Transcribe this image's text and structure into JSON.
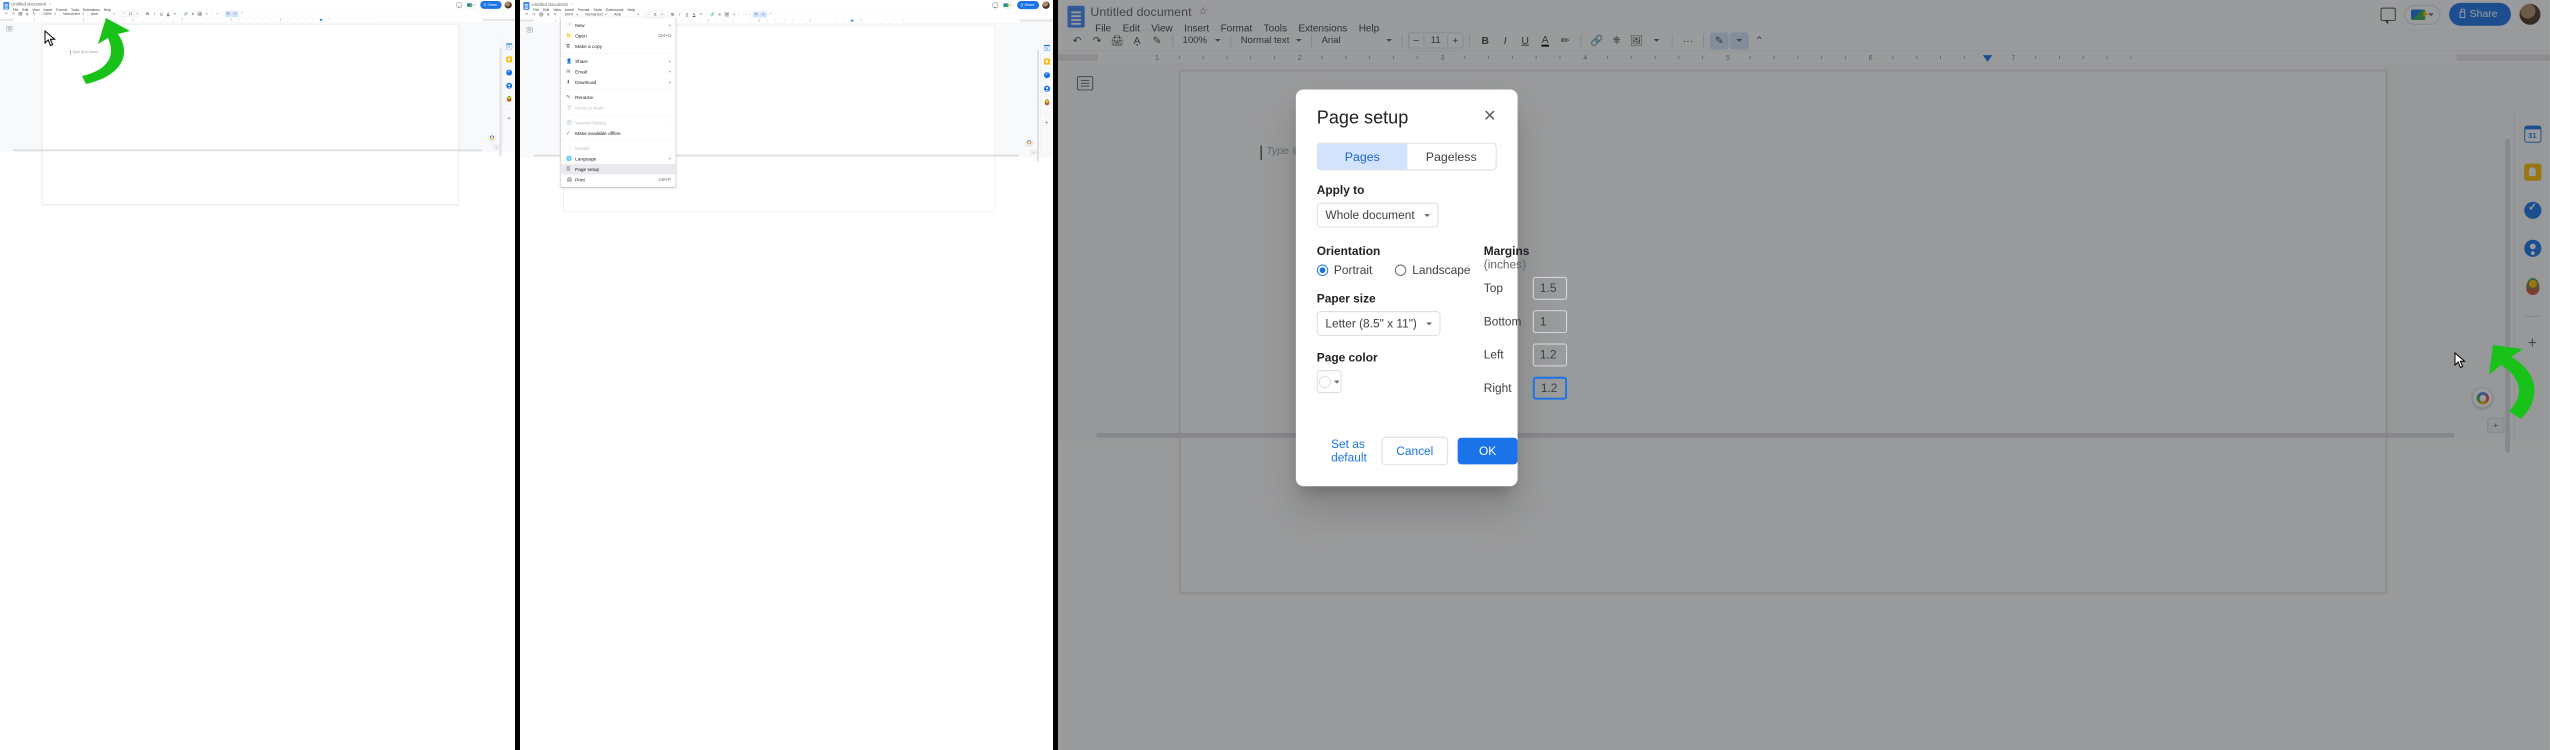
{
  "app": {
    "doc_title": "Untitled document",
    "star_icon": "star-icon",
    "menus": [
      "File",
      "Edit",
      "View",
      "Insert",
      "Format",
      "Tools",
      "Extensions",
      "Help"
    ],
    "share_label": "Share",
    "toolbar": {
      "undo": "undo-icon",
      "redo": "redo-icon",
      "print": "print-icon",
      "spellcheck": "spellcheck-icon",
      "paint_format": "paint-format-icon",
      "zoom": "100%",
      "style": "Normal text",
      "font": "Arial",
      "font_size": "11",
      "minus": "−",
      "plus": "+",
      "bold": "B",
      "italic": "I",
      "underline": "U",
      "text_color": "A",
      "highlight": "highlight-icon",
      "link": "link-icon",
      "comment": "add-comment-icon",
      "image": "insert-image-icon",
      "more": "···",
      "editing_mode": "editing-mode-icon",
      "collapse": "⌃"
    },
    "canvas": {
      "placeholder": "Type @ to insert",
      "outline_icon": "document-outline-icon"
    },
    "ruler": {
      "labels": [
        "1",
        "2",
        "3",
        "4",
        "5",
        "6",
        "7"
      ]
    },
    "rail": {
      "items": [
        "google-calendar-icon",
        "google-keep-icon",
        "google-tasks-icon",
        "google-contacts-icon",
        "google-maps-icon"
      ],
      "add_label": "+"
    }
  },
  "file_menu": {
    "groups": [
      [
        {
          "label": "New",
          "icon": "new-document-icon",
          "arrow": "▸",
          "disabled": false,
          "accel": ""
        },
        {
          "label": "Open",
          "icon": "folder-icon",
          "arrow": "",
          "disabled": false,
          "accel": "Ctrl+O"
        },
        {
          "label": "Make a copy",
          "icon": "copy-icon",
          "arrow": "",
          "disabled": false,
          "accel": ""
        }
      ],
      [
        {
          "label": "Share",
          "icon": "person-add-icon",
          "arrow": "▸",
          "disabled": false,
          "accel": ""
        },
        {
          "label": "Email",
          "icon": "envelope-icon",
          "arrow": "▸",
          "disabled": false,
          "accel": ""
        },
        {
          "label": "Download",
          "icon": "download-icon",
          "arrow": "▸",
          "disabled": false,
          "accel": ""
        }
      ],
      [
        {
          "label": "Rename",
          "icon": "pencil-icon",
          "arrow": "",
          "disabled": false,
          "accel": ""
        },
        {
          "label": "Move to trash",
          "icon": "trash-icon",
          "arrow": "",
          "disabled": true,
          "accel": ""
        }
      ],
      [
        {
          "label": "Version history",
          "icon": "clock-icon",
          "arrow": "▸",
          "disabled": true,
          "accel": ""
        },
        {
          "label": "Make available offline",
          "icon": "offline-icon",
          "arrow": "",
          "disabled": false,
          "accel": ""
        }
      ],
      [
        {
          "label": "Details",
          "icon": "info-icon",
          "arrow": "",
          "disabled": true,
          "accel": ""
        },
        {
          "label": "Language",
          "icon": "globe-icon",
          "arrow": "▸",
          "disabled": false,
          "accel": ""
        },
        {
          "label": "Page setup",
          "icon": "page-setup-icon",
          "arrow": "",
          "disabled": false,
          "accel": "",
          "highlighted": true
        },
        {
          "label": "Print",
          "icon": "printer-icon",
          "arrow": "",
          "disabled": false,
          "accel": "Ctrl+P"
        }
      ]
    ]
  },
  "page_setup": {
    "title": "Page setup",
    "close_icon": "✕",
    "tabs": [
      {
        "label": "Pages",
        "selected": true
      },
      {
        "label": "Pageless",
        "selected": false
      }
    ],
    "apply_to_label": "Apply to",
    "apply_to_value": "Whole document",
    "orientation_label": "Orientation",
    "orientation_options": [
      {
        "label": "Portrait",
        "selected": true
      },
      {
        "label": "Landscape",
        "selected": false
      }
    ],
    "paper_size_label": "Paper size",
    "paper_size_value": "Letter (8.5\" x 11\")",
    "page_color_label": "Page color",
    "page_color_value": "#ffffff",
    "margins_label": "Margins",
    "margins_units": "(inches)",
    "margins": [
      {
        "label": "Top",
        "value": "1.5",
        "focused": false
      },
      {
        "label": "Bottom",
        "value": "1",
        "focused": false
      },
      {
        "label": "Left",
        "value": "1.2",
        "focused": false
      },
      {
        "label": "Right",
        "value": "1.2",
        "focused": true
      }
    ],
    "set_default_label": "Set as default",
    "cancel_label": "Cancel",
    "ok_label": "OK"
  },
  "annotations": {
    "arrow_color": "#19c219",
    "steps": [
      {
        "target": "File menu",
        "panel": 1
      },
      {
        "target": "Page setup menu item",
        "panel": 2
      },
      {
        "target": "OK button",
        "panel": 3
      }
    ]
  }
}
